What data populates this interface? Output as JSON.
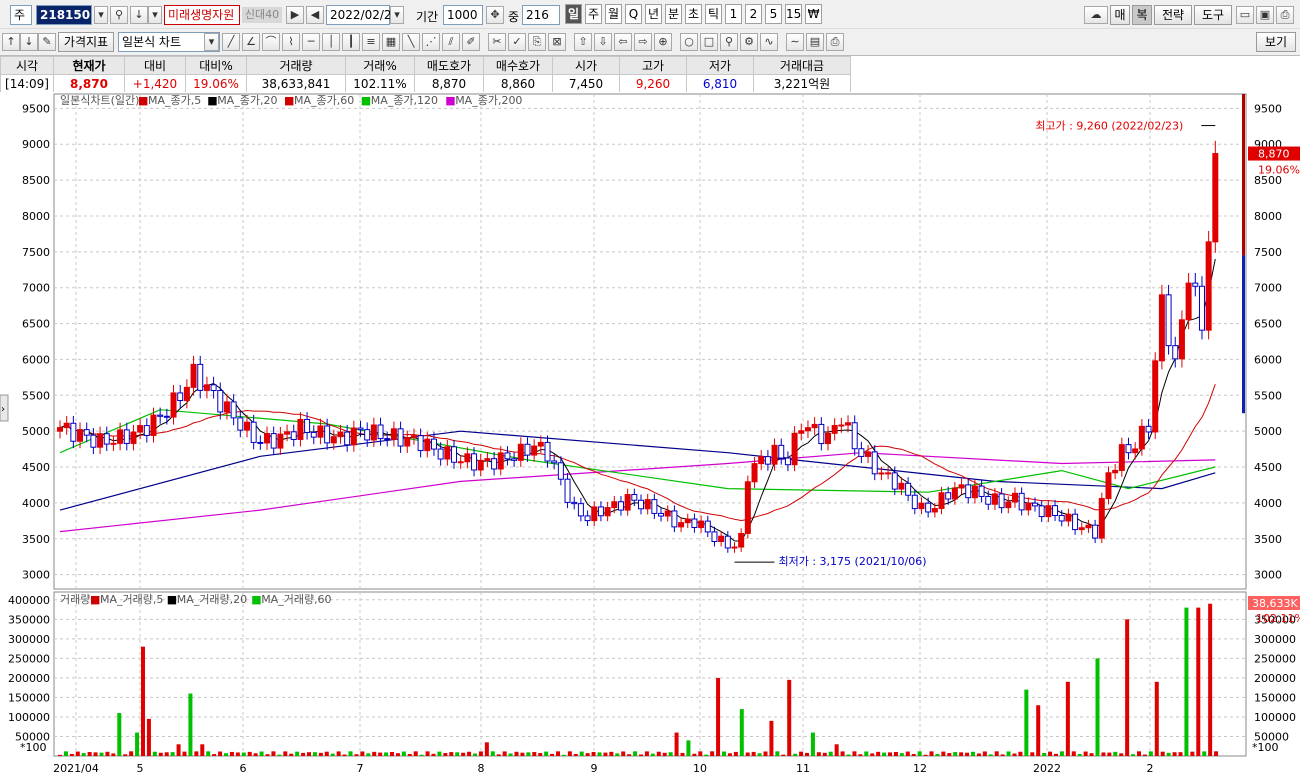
{
  "toolbar": {
    "stock_type": "주",
    "code": "218150",
    "name": "미래생명자원",
    "badge": "신대40",
    "date": "2022/02/23",
    "period_label": "기간",
    "period": "1000",
    "mid_label": "중",
    "mid_value": "216",
    "tabs": [
      "일",
      "주",
      "월",
      "Q",
      "년",
      "분",
      "초",
      "틱",
      "1",
      "2",
      "5",
      "15",
      "₩"
    ],
    "selected_tab": "일",
    "right_buttons": [
      "매",
      "복",
      "전략",
      "도구"
    ],
    "selected_right": "복",
    "indicator_button": "가격지표",
    "chart_type": "일본식 차트",
    "view_button": "보기"
  },
  "quote": {
    "headers": [
      "시각",
      "현재가",
      "대비",
      "대비%",
      "거래량",
      "거래%",
      "매도호가",
      "매수호가",
      "시가",
      "고가",
      "저가",
      "거래대금"
    ],
    "values": [
      "[14:09]",
      "8,870",
      "+1,420",
      "19.06%",
      "38,633,841",
      "102.11%",
      "8,870",
      "8,860",
      "7,450",
      "9,260",
      "6,810",
      "3,221억원"
    ]
  },
  "colors": {
    "up": "#e00000",
    "down": "#0000c8",
    "ma5": "#000000",
    "ma20": "#d00000",
    "ma60": "#00c000",
    "ma120": "#00008b",
    "ma200": "#d000d0"
  },
  "chart_data": [
    {
      "type": "candlestick",
      "title": "일본식차트(일간)",
      "legend": [
        "MA_종가,5",
        "MA_종가,20",
        "MA_종가,60",
        "MA_종가,120",
        "MA_종가,200"
      ],
      "ylim": [
        2800,
        9700
      ],
      "yticks": [
        3000,
        3500,
        4000,
        4500,
        5000,
        5500,
        6000,
        6500,
        7000,
        7500,
        8000,
        8500,
        9000,
        9500
      ],
      "xticks": [
        "2021/04",
        "5",
        "6",
        "7",
        "8",
        "9",
        "10",
        "11",
        "12",
        "2022",
        "2"
      ],
      "annotations": {
        "high": "최고가 : 9,260 (2022/02/23)",
        "low": "최저가 : 3,175 (2021/10/06)",
        "last_price": "8,870",
        "last_change": "19.06%"
      },
      "close_path": [
        [
          0,
          5050
        ],
        [
          3,
          4950
        ],
        [
          6,
          4850
        ],
        [
          9,
          4900
        ],
        [
          12,
          5000
        ],
        [
          15,
          5200
        ],
        [
          18,
          5500
        ],
        [
          20,
          5800
        ],
        [
          22,
          5600
        ],
        [
          24,
          5400
        ],
        [
          26,
          5200
        ],
        [
          28,
          5000
        ],
        [
          30,
          4850
        ],
        [
          33,
          4900
        ],
        [
          36,
          5050
        ],
        [
          39,
          4950
        ],
        [
          42,
          4900
        ],
        [
          45,
          5000
        ],
        [
          48,
          4950
        ],
        [
          51,
          4900
        ],
        [
          54,
          4850
        ],
        [
          57,
          4700
        ],
        [
          60,
          4600
        ],
        [
          63,
          4550
        ],
        [
          66,
          4600
        ],
        [
          69,
          4700
        ],
        [
          71,
          4800
        ],
        [
          73,
          4700
        ],
        [
          75,
          4300
        ],
        [
          77,
          3900
        ],
        [
          79,
          3800
        ],
        [
          81,
          3900
        ],
        [
          83,
          3950
        ],
        [
          85,
          4050
        ],
        [
          87,
          4000
        ],
        [
          89,
          3900
        ],
        [
          91,
          3800
        ],
        [
          93,
          3700
        ],
        [
          95,
          3750
        ],
        [
          97,
          3600
        ],
        [
          99,
          3450
        ],
        [
          101,
          3400
        ],
        [
          102,
          3500
        ],
        [
          103,
          4400
        ],
        [
          105,
          4600
        ],
        [
          107,
          4700
        ],
        [
          109,
          4600
        ],
        [
          111,
          5100
        ],
        [
          113,
          5000
        ],
        [
          115,
          4900
        ],
        [
          117,
          5200
        ],
        [
          119,
          4800
        ],
        [
          121,
          4600
        ],
        [
          123,
          4400
        ],
        [
          125,
          4300
        ],
        [
          127,
          4100
        ],
        [
          129,
          3900
        ],
        [
          131,
          3950
        ],
        [
          133,
          4150
        ],
        [
          135,
          4200
        ],
        [
          137,
          4150
        ],
        [
          139,
          4050
        ],
        [
          141,
          4000
        ],
        [
          143,
          4050
        ],
        [
          145,
          3950
        ],
        [
          147,
          3900
        ],
        [
          149,
          3850
        ],
        [
          151,
          3750
        ],
        [
          153,
          3650
        ],
        [
          155,
          3600
        ],
        [
          157,
          4400
        ],
        [
          159,
          4700
        ],
        [
          161,
          4800
        ],
        [
          163,
          5100
        ],
        [
          165,
          6800
        ],
        [
          167,
          5900
        ],
        [
          169,
          7200
        ],
        [
          171,
          6500
        ],
        [
          173,
          8870
        ]
      ],
      "candle_count": 174,
      "ma_paths": {
        "ma120": [
          [
            0,
            3900
          ],
          [
            30,
            4650
          ],
          [
            60,
            5000
          ],
          [
            100,
            4700
          ],
          [
            140,
            4300
          ],
          [
            165,
            4200
          ],
          [
            173,
            4420
          ]
        ],
        "ma200": [
          [
            0,
            3600
          ],
          [
            30,
            3900
          ],
          [
            60,
            4300
          ],
          [
            100,
            4550
          ],
          [
            120,
            4700
          ],
          [
            150,
            4550
          ],
          [
            173,
            4600
          ]
        ],
        "ma60": [
          [
            0,
            4700
          ],
          [
            15,
            5300
          ],
          [
            40,
            5100
          ],
          [
            70,
            4600
          ],
          [
            100,
            4200
          ],
          [
            130,
            4150
          ],
          [
            150,
            4450
          ],
          [
            160,
            4200
          ],
          [
            173,
            4500
          ]
        ]
      }
    },
    {
      "type": "bar",
      "title": "거래량",
      "legend": [
        "MA_거래량,5",
        "MA_거래량,20",
        "MA_거래량,60"
      ],
      "ylim": [
        0,
        420000
      ],
      "yticks": [
        50000,
        100000,
        150000,
        200000,
        250000,
        300000,
        350000,
        400000
      ],
      "unit_label": "*100",
      "last_volume": "38,633K",
      "last_ratio": "102.11%",
      "spikes": [
        [
          10,
          110000
        ],
        [
          13,
          60000
        ],
        [
          14,
          280000
        ],
        [
          15,
          95000
        ],
        [
          20,
          30000
        ],
        [
          22,
          160000
        ],
        [
          24,
          30000
        ],
        [
          72,
          35000
        ],
        [
          104,
          60000
        ],
        [
          106,
          40000
        ],
        [
          111,
          200000
        ],
        [
          115,
          120000
        ],
        [
          120,
          90000
        ],
        [
          123,
          195000
        ],
        [
          127,
          60000
        ],
        [
          131,
          30000
        ],
        [
          163,
          170000
        ],
        [
          165,
          130000
        ],
        [
          170,
          190000
        ],
        [
          175,
          250000
        ],
        [
          180,
          350000
        ],
        [
          185,
          190000
        ],
        [
          190,
          380000
        ],
        [
          192,
          380000
        ],
        [
          194,
          390000
        ]
      ]
    }
  ]
}
